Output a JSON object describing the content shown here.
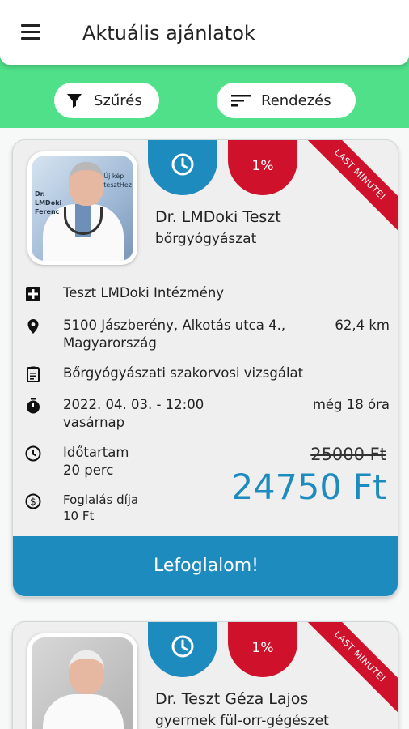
{
  "header": {
    "title": "Aktuális ajánlatok",
    "menu_icon": "menu-icon"
  },
  "toolbar": {
    "filter_label": "Szűrés",
    "sort_label": "Rendezés"
  },
  "offers": [
    {
      "photo_text_left": "Dr.\nLMDoki\nFerenc",
      "photo_text_right": "Új kép\ntesztHez",
      "discount": "1%",
      "ribbon": "LAST MINUTE!",
      "doctor_name": "Dr. LMDoki Teszt",
      "specialty": "bőrgyógyászat",
      "institution": "Teszt LMDoki Intézmény",
      "address_line1": "5100 Jászberény, Alkotás utca 4.,",
      "address_line2": "Magyarország",
      "distance": "62,4 km",
      "service": "Bőrgyógyászati szakorvosi vizsgálat",
      "datetime": "2022. 04. 03. - 12:00",
      "weekday": "vasárnap",
      "remaining": "még 18 óra",
      "duration_label": "Időtartam",
      "duration_value": "20 perc",
      "fee_label": "Foglalás díja",
      "fee_value": "10 Ft",
      "old_price": "25000 Ft",
      "new_price": "24750 Ft",
      "book_label": "Lefoglalom!"
    },
    {
      "discount": "1%",
      "ribbon": "LAST MINUTE!",
      "doctor_name": "Dr. Teszt Géza Lajos",
      "specialty": "gyermek fül-orr-gégészet"
    }
  ],
  "colors": {
    "accent": "#1e8bbf",
    "green": "#4fe089",
    "red": "#d0112b"
  }
}
